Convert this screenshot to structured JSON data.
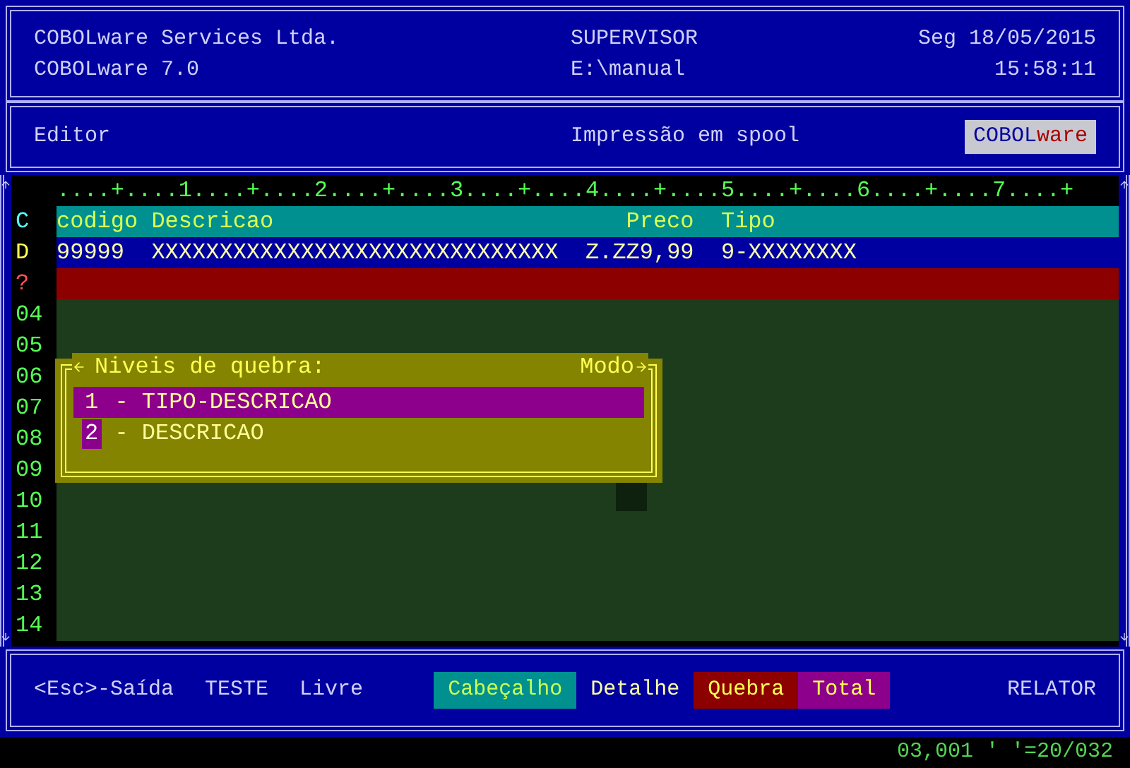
{
  "header": {
    "company": "COBOLware Services Ltda.",
    "product": "COBOLware 7.0",
    "user": "SUPERVISOR",
    "path": "E:\\manual",
    "date": "Seg 18/05/2015",
    "time": "15:58:11"
  },
  "toolbar": {
    "module": "Editor",
    "title": "Impressão em spool",
    "badge_left": "COBOL",
    "badge_right": "ware"
  },
  "editor": {
    "ruler": "....+....1....+....2....+....3....+....4....+....5....+....6....+....7....+",
    "rows": [
      {
        "label": "C",
        "kind": "header",
        "cells": [
          "codigo",
          "Descricao",
          "Preco",
          "Tipo"
        ]
      },
      {
        "label": "D",
        "kind": "detail",
        "cells": [
          "99999",
          "XXXXXXXXXXXXXXXXXXXXXXXXXXXXXX",
          "Z.ZZ9,99",
          "9-XXXXXXXX"
        ]
      },
      {
        "label": "?",
        "kind": "break",
        "cells": []
      },
      {
        "label": "04",
        "kind": "empty",
        "cells": []
      },
      {
        "label": "05",
        "kind": "empty",
        "cells": []
      },
      {
        "label": "06",
        "kind": "empty",
        "cells": []
      },
      {
        "label": "07",
        "kind": "empty",
        "cells": []
      },
      {
        "label": "08",
        "kind": "empty",
        "cells": []
      },
      {
        "label": "09",
        "kind": "empty",
        "cells": []
      },
      {
        "label": "10",
        "kind": "empty",
        "cells": []
      },
      {
        "label": "11",
        "kind": "empty",
        "cells": []
      },
      {
        "label": "12",
        "kind": "empty",
        "cells": []
      },
      {
        "label": "13",
        "kind": "empty",
        "cells": []
      },
      {
        "label": "14",
        "kind": "empty",
        "cells": []
      }
    ]
  },
  "popup": {
    "title": "Niveis de quebra:",
    "mode": "Modo",
    "items": [
      {
        "number": "1",
        "label": "- TIPO-DESCRICAO",
        "selected": true,
        "cursor": false
      },
      {
        "number": "2",
        "label": "- DESCRICAO",
        "selected": false,
        "cursor": true
      }
    ]
  },
  "bottom_bar": {
    "keys": [
      "<Esc>-Saída",
      "TESTE",
      "Livre"
    ],
    "sections": [
      {
        "label": "Cabeçalho",
        "color": "#009090"
      },
      {
        "label": "Detalhe",
        "color": "#0000a0"
      },
      {
        "label": "Quebra",
        "color": "#8c0000"
      },
      {
        "label": "Total",
        "color": "#8c008c"
      }
    ],
    "report": "RELATOR"
  },
  "status_bar": {
    "position": "03,001 ' '=20/032"
  }
}
